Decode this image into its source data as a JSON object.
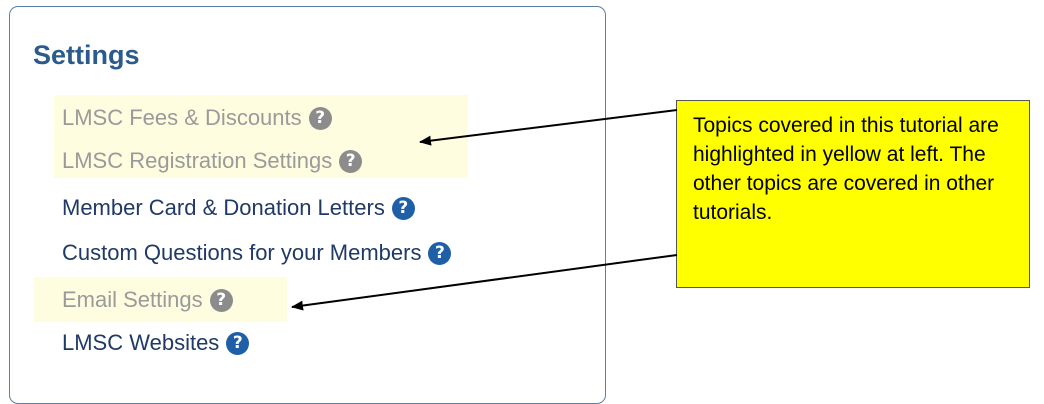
{
  "settings": {
    "title": "Settings",
    "items": [
      {
        "label": "LMSC Fees & Discounts",
        "highlighted": true,
        "icon": "help-question-icon"
      },
      {
        "label": "LMSC Registration Settings",
        "highlighted": true,
        "icon": "help-question-icon"
      },
      {
        "label": "Member Card & Donation Letters",
        "highlighted": false,
        "icon": "help-question-icon"
      },
      {
        "label": "Custom Questions for your Members",
        "highlighted": false,
        "icon": "help-question-icon"
      },
      {
        "label": "Email Settings",
        "highlighted": true,
        "icon": "help-question-icon"
      },
      {
        "label": "LMSC Websites",
        "highlighted": false,
        "icon": "help-question-icon"
      }
    ],
    "help_glyph": "?"
  },
  "callout": {
    "text": "Topics covered in this tutorial are highlighted in yellow at left. The other topics are covered in other tutorials."
  },
  "colors": {
    "title": "#2b5a8c",
    "link_text": "#203a66",
    "dimmed_text": "#9a9a9a",
    "highlight_background": "#fffde0",
    "help_icon_blue": "#1f5fa8",
    "help_icon_gray": "#8c8c8c",
    "callout_background": "#ffff00"
  }
}
